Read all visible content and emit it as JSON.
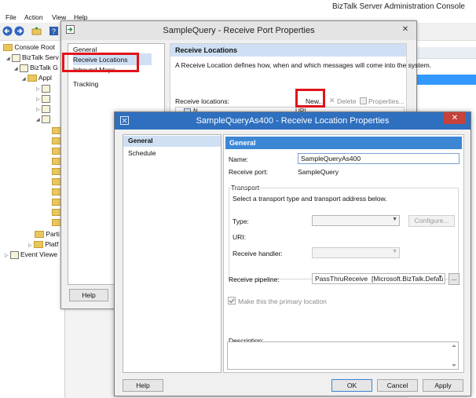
{
  "console": {
    "title": "BizTalk Server Administration Console",
    "menu": [
      "File",
      "Action",
      "View",
      "Help"
    ],
    "tree": {
      "root": "Console Root",
      "biztalk_server": "BizTalk Serv",
      "biztalk_group": "BizTalk G",
      "applications": "Appl",
      "parties": "Parti",
      "platform": "Platf",
      "event_viewer": "Event Viewe"
    }
  },
  "receive_port_dialog": {
    "title": "SampleQuery - Receive Port Properties",
    "close_glyph": "✕",
    "nav": [
      "General",
      "Receive Locations",
      "Inbound Maps",
      "Tracking"
    ],
    "selected_nav": "Receive Locations",
    "header": "Receive Locations",
    "description": "A Receive Location defines how, when and which messages will come into the system.",
    "list_label": "Receive locations:",
    "new_button": "New...",
    "delete_button": "Delete",
    "properties_button": "Properties...",
    "column_name": "N",
    "column_uri": "URI",
    "help_button": "Help"
  },
  "receive_location_dialog": {
    "title": "SampleQueryAs400 - Receive Location Properties",
    "close_glyph": "✕",
    "nav": [
      "General",
      "Schedule"
    ],
    "selected_nav": "General",
    "header": "General",
    "name_label": "Name:",
    "name_value": "SampleQueryAs400",
    "receive_port_label": "Receive port:",
    "receive_port_value": "SampleQuery",
    "transport_group": "Transport",
    "transport_instructions": "Select a transport type and transport address below.",
    "type_label": "Type:",
    "type_value": "",
    "configure_button": "Configure...",
    "uri_label": "URI:",
    "receive_handler_label": "Receive handler:",
    "receive_handler_value": "",
    "receive_pipeline_label": "Receive pipeline:",
    "receive_pipeline_value": "PassThruReceive",
    "receive_pipeline_assembly": "[Microsoft.BizTalk.Defau",
    "pipeline_config_button": "...",
    "primary_location_label": "Make this the primary location",
    "primary_location_checked": true,
    "description_label": "Description:",
    "description_value": "",
    "help_button": "Help",
    "ok_button": "OK",
    "cancel_button": "Cancel",
    "apply_button": "Apply"
  },
  "colors": {
    "highlight": "#e0141a",
    "active_titlebar": "#2e6fbf",
    "section_header": "#3c86d6",
    "selection": "#cfe0f4"
  }
}
